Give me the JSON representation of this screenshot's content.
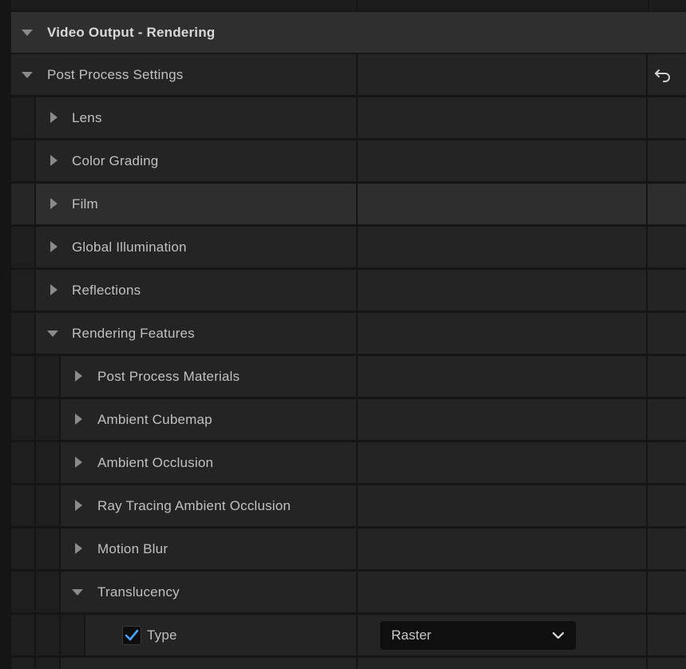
{
  "panel": {
    "section_title": "Video Output - Rendering",
    "rows": [
      {
        "label": "Post Process Settings"
      },
      {
        "label": "Lens"
      },
      {
        "label": "Color Grading"
      },
      {
        "label": "Film"
      },
      {
        "label": "Global Illumination"
      },
      {
        "label": "Reflections"
      },
      {
        "label": "Rendering Features"
      },
      {
        "label": "Post Process Materials"
      },
      {
        "label": "Ambient Cubemap"
      },
      {
        "label": "Ambient Occlusion"
      },
      {
        "label": "Ray Tracing Ambient Occlusion"
      },
      {
        "label": "Motion Blur"
      },
      {
        "label": "Translucency"
      },
      {
        "label": "Type",
        "checked": true,
        "value": "Raster"
      }
    ]
  },
  "colors": {
    "accent": "#4aa3ff",
    "row_bg": "#242424",
    "header_bg": "#2f2f2f",
    "hover_bg": "#2e2e2e"
  }
}
